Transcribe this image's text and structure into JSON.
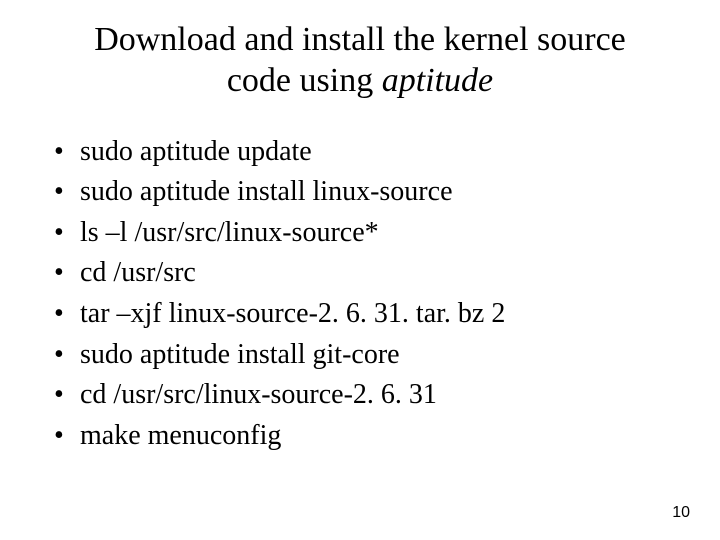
{
  "title": {
    "line1": "Download and install the kernel source",
    "line2_prefix": "code using ",
    "line2_italic": "aptitude"
  },
  "items": [
    "sudo aptitude update",
    "sudo aptitude install linux-source",
    "ls –l /usr/src/linux-source*",
    "cd /usr/src",
    "tar –xjf linux-source-2. 6. 31. tar. bz 2",
    "sudo aptitude install git-core",
    "cd /usr/src/linux-source-2. 6. 31",
    "make menuconfig"
  ],
  "page_number": "10"
}
